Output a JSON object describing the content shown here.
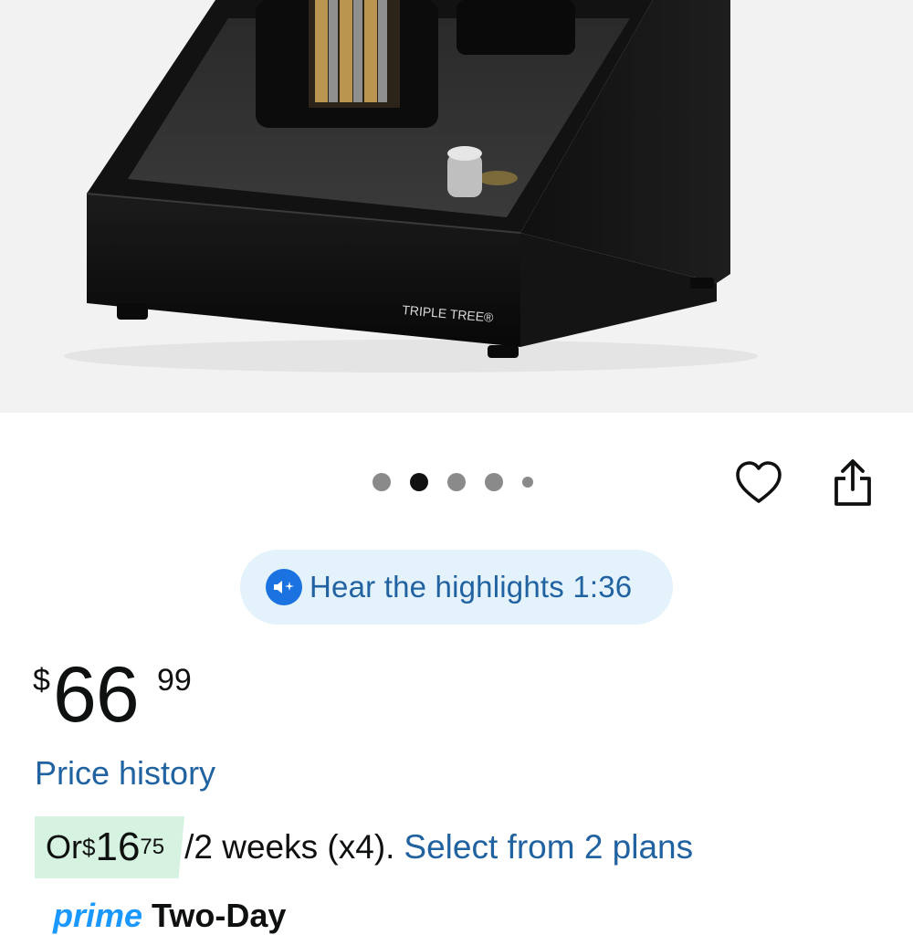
{
  "product_image": {
    "brand_label": "TRIPLE TREE®"
  },
  "carousel": {
    "dots": [
      "inactive",
      "active",
      "inactive",
      "inactive",
      "small"
    ]
  },
  "actions": {
    "favorite_icon": "heart-icon",
    "share_icon": "share-icon"
  },
  "highlights": {
    "label": "Hear the highlights 1:36",
    "icon": "speaker-sparkle-icon",
    "accent": "#1a73e0"
  },
  "price": {
    "symbol": "$",
    "whole": "66",
    "fraction": "99"
  },
  "price_history": {
    "label": "Price history"
  },
  "installment": {
    "prefix": "Or ",
    "symbol": "$",
    "amount": "16",
    "fraction": "75",
    "period": " /2 weeks (x4).",
    "link": "Select from 2 plans",
    "badge_color": "#d6f2e0"
  },
  "delivery": {
    "prime": "prime",
    "speed": "Two-Day"
  },
  "colors": {
    "link": "#2162a1",
    "text": "#0f1111"
  }
}
